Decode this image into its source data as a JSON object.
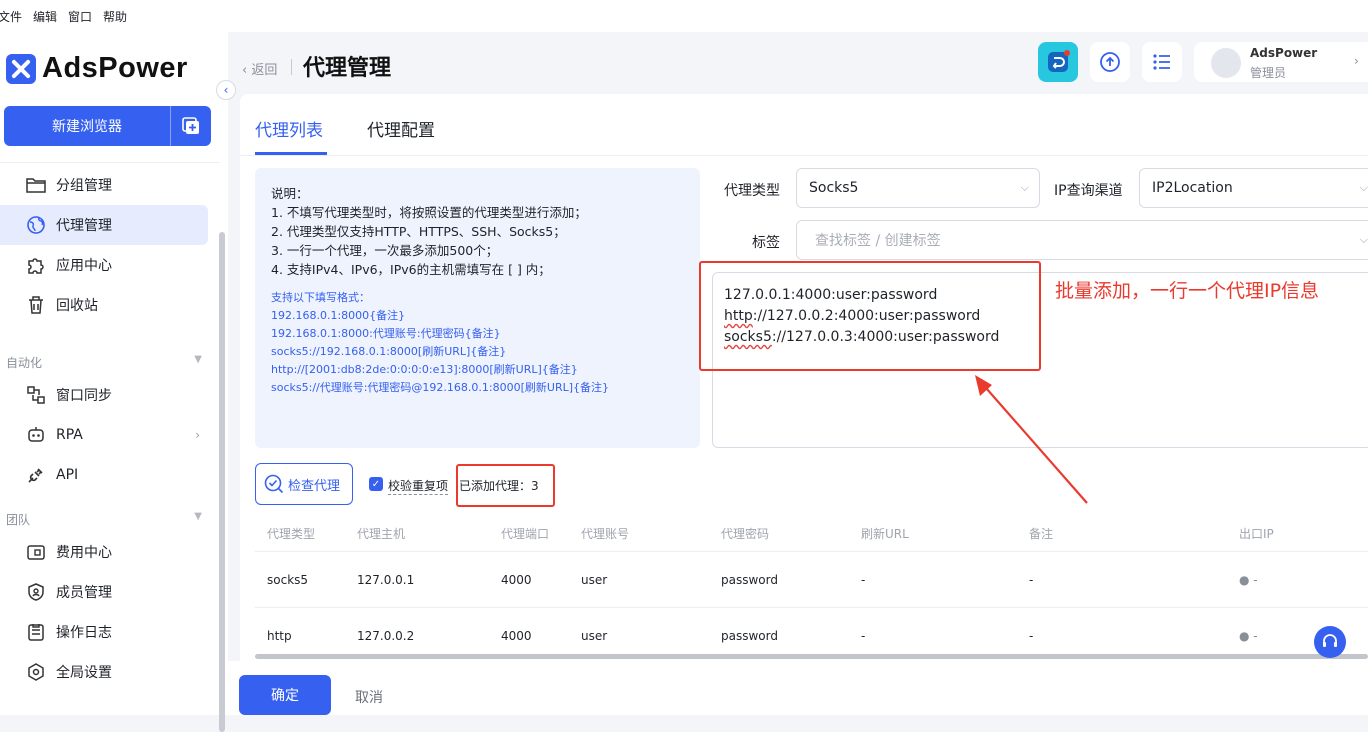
{
  "menubar": {
    "items": [
      "文件",
      "编辑",
      "窗口",
      "帮助"
    ]
  },
  "app": {
    "name": "AdsPower",
    "brand_color": "#3560f0"
  },
  "sidebar": {
    "new_browser": "新建浏览器",
    "items_top": [
      {
        "label": "分组管理",
        "icon": "folder-icon"
      },
      {
        "label": "代理管理",
        "icon": "proxy-globe-icon",
        "active": true
      },
      {
        "label": "应用中心",
        "icon": "puzzle-icon"
      },
      {
        "label": "回收站",
        "icon": "trash-icon"
      }
    ],
    "section_automation": "自动化",
    "items_auto": [
      {
        "label": "窗口同步",
        "icon": "sync-windows-icon"
      },
      {
        "label": "RPA",
        "icon": "robot-icon"
      },
      {
        "label": "API",
        "icon": "plug-icon"
      }
    ],
    "section_team": "团队",
    "items_team": [
      {
        "label": "费用中心",
        "icon": "wallet-icon"
      },
      {
        "label": "成员管理",
        "icon": "shield-user-icon"
      },
      {
        "label": "操作日志",
        "icon": "log-icon"
      },
      {
        "label": "全局设置",
        "icon": "settings-hex-icon"
      }
    ]
  },
  "header": {
    "back": "返回",
    "title": "代理管理",
    "user": {
      "name": "AdsPower",
      "role": "管理员"
    }
  },
  "tabs": [
    "代理列表",
    "代理配置"
  ],
  "info": {
    "lines": [
      "说明：",
      "1. 不填写代理类型时，将按照设置的代理类型进行添加；",
      "2. 代理类型仅支持HTTP、HTTPS、SSH、Socks5；",
      "3. 一行一个代理，一次最多添加500个；",
      "4. 支持IPv4、IPv6，IPv6的主机需填写在 [ ] 内；"
    ],
    "format_title": "支持以下填写格式：",
    "formats": [
      "192.168.0.1:8000{备注}",
      "192.168.0.1:8000:代理账号:代理密码{备注}",
      "socks5://192.168.0.1:8000[刷新URL]{备注}",
      "http://[2001:db8:2de:0:0:0:0:e13]:8000[刷新URL]{备注}",
      "socks5://代理账号:代理密码@192.168.0.1:8000[刷新URL]{备注}"
    ]
  },
  "form": {
    "proxy_type_label": "代理类型",
    "proxy_type_value": "Socks5",
    "ip_channel_label": "IP查询渠道",
    "ip_channel_value": "IP2Location",
    "tag_label": "标签",
    "tag_placeholder": "查找标签 / 创建标签",
    "textarea": {
      "line1": "127.0.0.1:4000:user:password",
      "line2_a": "http",
      "line2_b": "://127.0.0.2:4000:user:password",
      "line3_a": "socks5",
      "line3_b": "://127.0.0.3:4000:user:password"
    }
  },
  "annotation": "批量添加，一行一个代理IP信息",
  "actions": {
    "check_proxy": "检查代理",
    "dedupe_label": "校验重复项",
    "dedupe_checked": true,
    "added_label": "已添加代理：3"
  },
  "table": {
    "headers": [
      "代理类型",
      "代理主机",
      "代理端口",
      "代理账号",
      "代理密码",
      "刷新URL",
      "备注",
      "出口IP"
    ],
    "rows": [
      [
        "socks5",
        "127.0.0.1",
        "4000",
        "user",
        "password",
        "-",
        "-",
        "-"
      ],
      [
        "http",
        "127.0.0.2",
        "4000",
        "user",
        "password",
        "-",
        "-",
        "-"
      ]
    ]
  },
  "footer": {
    "ok": "确定",
    "cancel": "取消"
  }
}
